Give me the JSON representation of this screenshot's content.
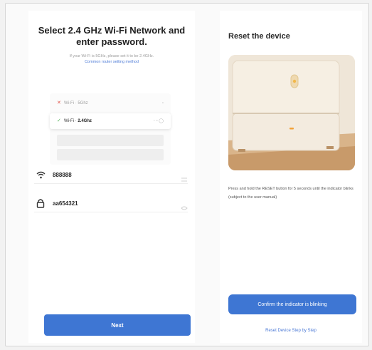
{
  "left": {
    "title": "Select 2.4 GHz Wi-Fi Network and enter password.",
    "hint": "If your Wi-Fi is 5GHz, please set it to be 2.4GHz.",
    "hint_link": "Common router setting method",
    "illustration": {
      "rows": [
        {
          "icon": "✕",
          "text": "Wi-Fi · 5Ghz",
          "state": "unsupported"
        },
        {
          "icon": "✓",
          "text_prefix": "Wi-Fi · ",
          "text_strong": "2.4Ghz",
          "state": "selected"
        },
        {
          "text": "",
          "state": "dim"
        },
        {
          "text": "",
          "state": "dim"
        }
      ]
    },
    "wifi_name": "888888",
    "password": "aa654321",
    "next_label": "Next"
  },
  "right": {
    "title": "Reset the device",
    "description": "Press and hold the RESET button for 5 seconds until the indicator blinks (subject to the user manual)",
    "confirm_label": "Confirm the indicator is blinking",
    "reset_link": "Reset Device Step by Step"
  },
  "colors": {
    "accent": "#3e76d3",
    "link": "#4c7ad6",
    "error": "#e0534a"
  }
}
